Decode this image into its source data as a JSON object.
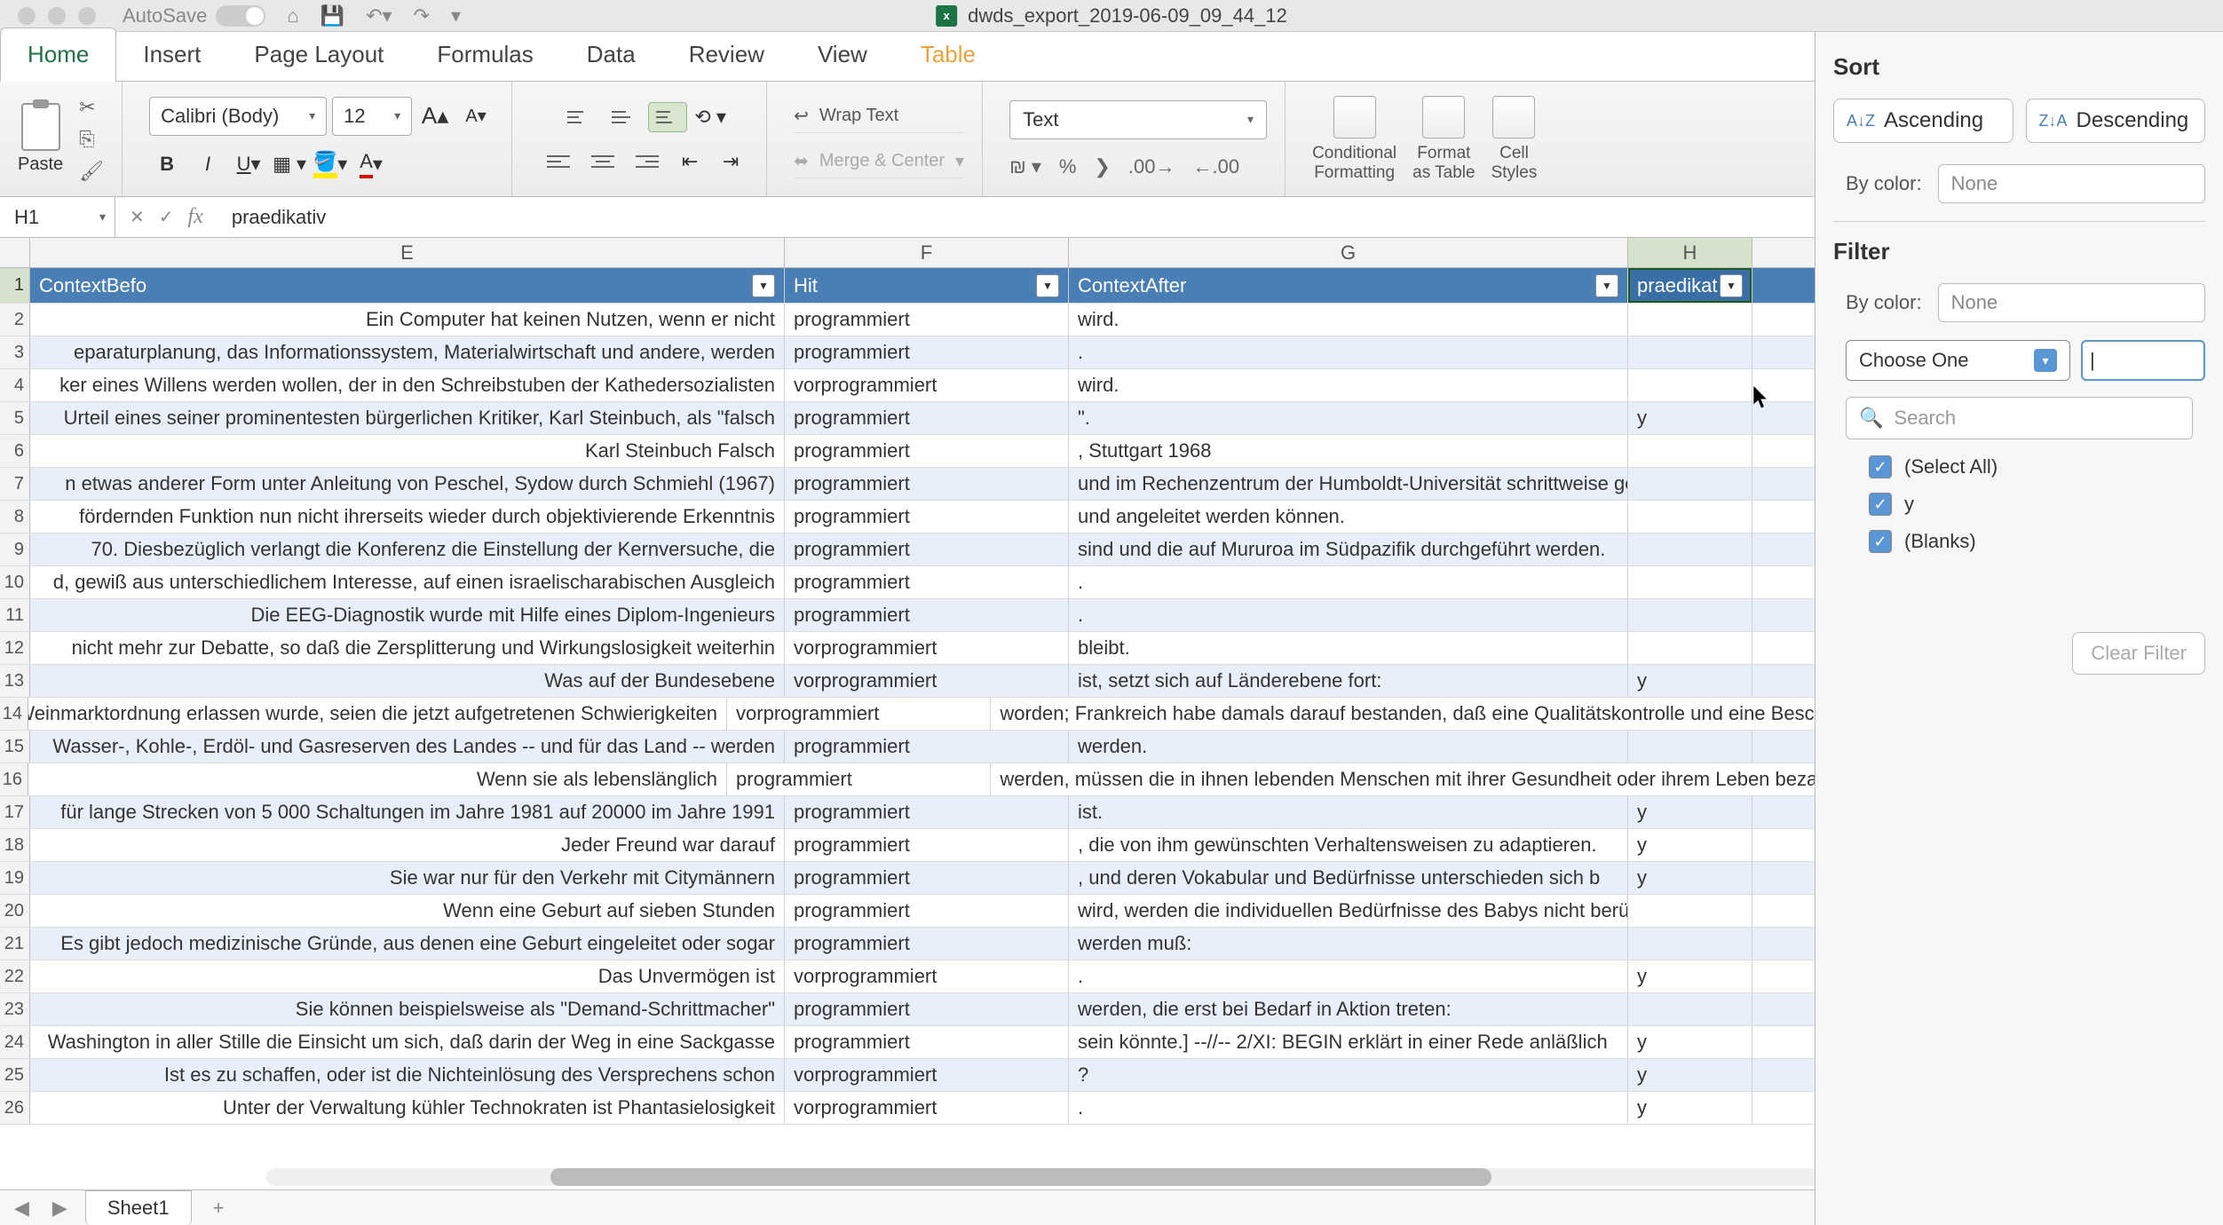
{
  "title": "dwds_export_2019-06-09_09_44_12",
  "autosave_label": "AutoSave",
  "autosave_state": "OFF",
  "tabs": [
    "Home",
    "Insert",
    "Page Layout",
    "Formulas",
    "Data",
    "Review",
    "View",
    "Table"
  ],
  "ribbon": {
    "paste": "Paste",
    "font_name": "Calibri (Body)",
    "font_size": "12",
    "wrap": "Wrap Text",
    "merge": "Merge & Center",
    "number_format": "Text",
    "cond_fmt": "Conditional\nFormatting",
    "fmt_table": "Format\nas Table",
    "cell_styles": "Cell\nStyles"
  },
  "namebox": "H1",
  "formula": "praedikativ",
  "columns": [
    "E",
    "F",
    "G",
    "H"
  ],
  "col_widths": {
    "E": 850,
    "F": 320,
    "G": 630,
    "H": 140
  },
  "header_row": {
    "E": "ContextBefo",
    "F": "Hit",
    "G": "ContextAfter",
    "H": "praedikat"
  },
  "rows": [
    {
      "n": 2,
      "E": "Ein Computer hat keinen Nutzen, wenn er nicht",
      "F": "programmiert",
      "G": "wird.",
      "H": ""
    },
    {
      "n": 3,
      "E": "eparaturplanung, das Informationssystem, Materialwirtschaft und andere, werden",
      "F": "programmiert",
      "G": ".",
      "H": ""
    },
    {
      "n": 4,
      "E": "ker eines Willens werden wollen, der in den Schreibstuben der Kathedersozialisten",
      "F": "vorprogrammiert",
      "G": "wird.",
      "H": ""
    },
    {
      "n": 5,
      "E": "Urteil eines seiner prominentesten bürgerlichen Kritiker, Karl Steinbuch, als \"falsch",
      "F": "programmiert",
      "G": "\".",
      "H": "y"
    },
    {
      "n": 6,
      "E": "Karl Steinbuch Falsch",
      "F": "programmiert",
      "G": ", Stuttgart 1968",
      "H": ""
    },
    {
      "n": 7,
      "E": "n etwas anderer Form unter Anleitung von Peschel, Sydow durch Schmiehl (1967)",
      "F": "programmiert",
      "G": "und im Rechenzentrum der Humboldt-Universität schrittweise geprüft.",
      "H": ""
    },
    {
      "n": 8,
      "E": "fördernden Funktion nun nicht ihrerseits wieder durch objektivierende Erkenntnis",
      "F": "programmiert",
      "G": "und angeleitet werden können.",
      "H": ""
    },
    {
      "n": 9,
      "E": "70. Diesbezüglich verlangt die Konferenz die Einstellung der Kernversuche, die",
      "F": "programmiert",
      "G": "sind und die auf Mururoa im Südpazifik durchgeführt werden.",
      "H": ""
    },
    {
      "n": 10,
      "E": "d, gewiß aus unterschiedlichem Interesse, auf einen israelischarabischen Ausgleich",
      "F": "programmiert",
      "G": ".",
      "H": ""
    },
    {
      "n": 11,
      "E": "Die EEG-Diagnostik wurde mit Hilfe eines Diplom-Ingenieurs",
      "F": "programmiert",
      "G": ".",
      "H": ""
    },
    {
      "n": 12,
      "E": "nicht mehr zur Debatte, so daß die Zersplitterung und Wirkungslosigkeit weiterhin",
      "F": "vorprogrammiert",
      "G": "bleibt.",
      "H": ""
    },
    {
      "n": 13,
      "E": "Was auf der Bundesebene",
      "F": "vorprogrammiert",
      "G": "ist, setzt sich auf Länderebene fort:",
      "H": "y"
    },
    {
      "n": 14,
      "E": "e Weinmarktordnung erlassen wurde, seien die jetzt aufgetretenen Schwierigkeiten",
      "F": "vorprogrammiert",
      "G": "worden; Frankreich habe damals darauf bestanden, daß eine Qualitätskontrolle und eine Beschränkung der Anbaufläche",
      "H": "",
      "overflow": true
    },
    {
      "n": 15,
      "E": "Wasser-, Kohle-, Erdöl- und Gasreserven des Landes -- und für das Land -- werden",
      "F": "programmiert",
      "G": "werden.",
      "H": ""
    },
    {
      "n": 16,
      "E": "Wenn sie als lebenslänglich",
      "F": "programmiert",
      "G": "werden, müssen die in ihnen lebenden Menschen mit ihrer Gesundheit oder ihrem Leben bezahlen.",
      "H": "",
      "overflow": true
    },
    {
      "n": 17,
      "E": "für lange Strecken von 5 000 Schaltungen im Jahre 1981 auf 20000 im Jahre 1991",
      "F": "programmiert",
      "G": "ist.",
      "H": "y"
    },
    {
      "n": 18,
      "E": "Jeder Freund war darauf",
      "F": "programmiert",
      "G": ", die von ihm gewünschten Verhaltensweisen zu adaptieren.",
      "H": "y"
    },
    {
      "n": 19,
      "E": "Sie war nur für den Verkehr mit Citymännern",
      "F": "programmiert",
      "G": ", und deren Vokabular und Bedürfnisse unterschieden sich b",
      "H": "y"
    },
    {
      "n": 20,
      "E": "Wenn eine Geburt auf sieben Stunden",
      "F": "programmiert",
      "G": "wird, werden die individuellen Bedürfnisse des Babys nicht berücksichtigt.",
      "H": ""
    },
    {
      "n": 21,
      "E": "Es gibt jedoch medizinische Gründe, aus denen eine Geburt eingeleitet oder sogar",
      "F": "programmiert",
      "G": "werden muß:",
      "H": ""
    },
    {
      "n": 22,
      "E": "Das Unvermögen ist",
      "F": "vorprogrammiert",
      "G": ".",
      "H": "y"
    },
    {
      "n": 23,
      "E": "Sie können beispielsweise als \"Demand-Schrittmacher\"",
      "F": "programmiert",
      "G": "werden, die erst bei Bedarf in Aktion treten:",
      "H": ""
    },
    {
      "n": 24,
      "E": "Washington in aller Stille die Einsicht um sich, daß darin der Weg in eine Sackgasse",
      "F": "programmiert",
      "G": "sein könnte.] --//-- 2/XI: BEGIN erklärt in einer Rede anläßlich",
      "H": "y"
    },
    {
      "n": 25,
      "E": "Ist es zu schaffen, oder ist die Nichteinlösung des Versprechens schon",
      "F": "vorprogrammiert",
      "G": "?",
      "H": "y"
    },
    {
      "n": 26,
      "E": "Unter der Verwaltung kühler Technokraten ist Phantasielosigkeit",
      "F": "vorprogrammiert",
      "G": ".",
      "H": "y"
    }
  ],
  "sheet": "Sheet1",
  "panel": {
    "sort_title": "Sort",
    "asc": "Ascending",
    "desc": "Descending",
    "by_color": "By color:",
    "none": "None",
    "filter_title": "Filter",
    "choose": "Choose One",
    "search": "Search",
    "items": [
      "(Select All)",
      "y",
      "(Blanks)"
    ],
    "clear": "Clear Filter"
  }
}
